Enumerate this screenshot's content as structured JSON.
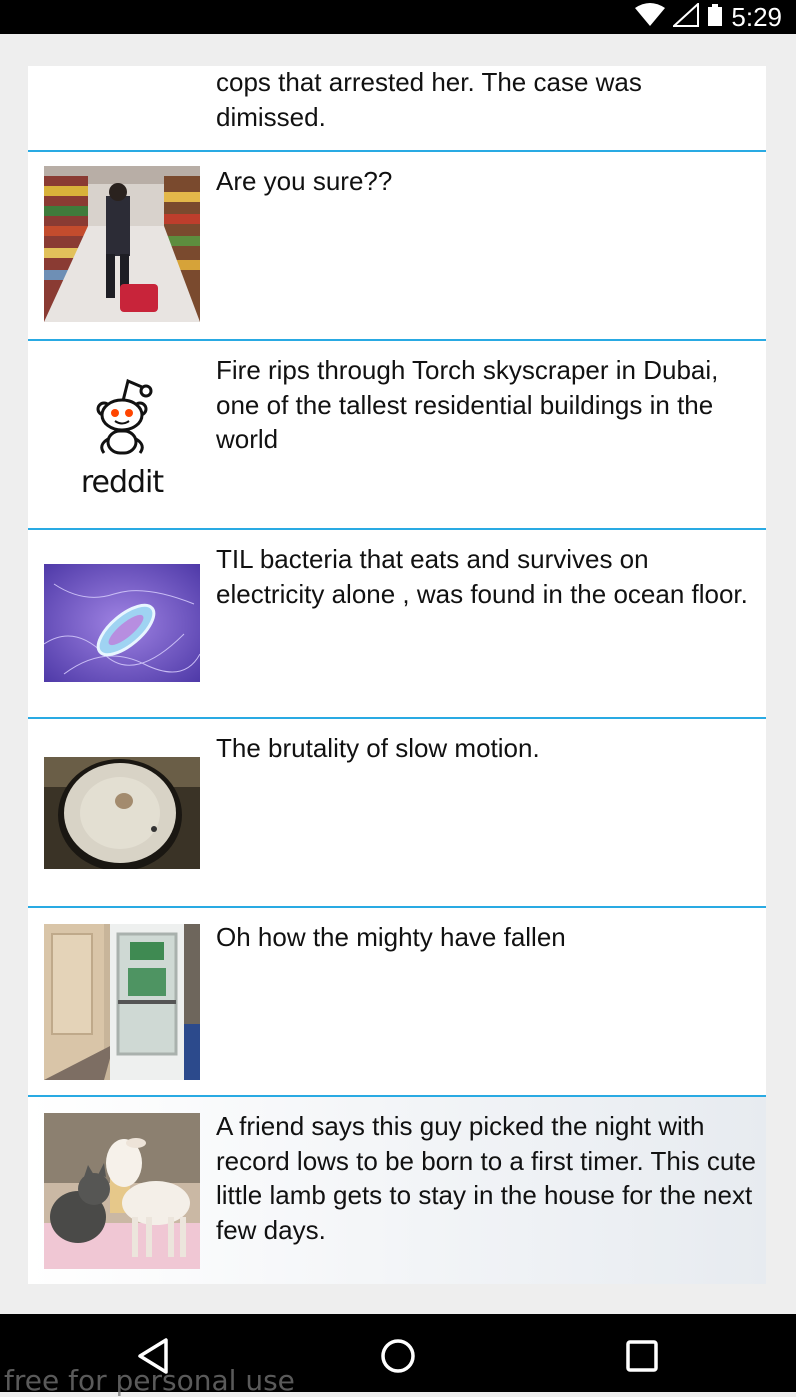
{
  "status_bar": {
    "time": "5:29",
    "icons": [
      "wifi-icon",
      "cell-signal-icon",
      "battery-icon"
    ]
  },
  "feed": {
    "posts": [
      {
        "title": "cops that arrested her. The case was dimissed.",
        "thumbnail": "none"
      },
      {
        "title": "Are you sure??",
        "thumbnail": "grocery-aisle-photo"
      },
      {
        "title": "Fire rips through Torch skyscraper in Dubai, one of the tallest residential buildings in the world",
        "thumbnail": "reddit-logo",
        "logo_text": "reddit"
      },
      {
        "title": "TIL bacteria that eats and survives on electricity alone , was found in the ocean floor.",
        "thumbnail": "bacteria-photo"
      },
      {
        "title": "The brutality of slow motion.",
        "thumbnail": "slow-motion-photo"
      },
      {
        "title": "Oh how the mighty have fallen",
        "thumbnail": "doorway-photo"
      },
      {
        "title": "A friend says this guy picked the night with record lows to be born to a first timer. This cute little lamb gets to stay in the house for the next few days.",
        "thumbnail": "lamb-photo"
      }
    ]
  },
  "nav_bar": {
    "buttons": [
      "back-icon",
      "home-icon",
      "recents-icon"
    ]
  },
  "watermark": "free for personal use",
  "colors": {
    "divider": "#29aae3",
    "background": "#eeeeee",
    "bars": "#000000"
  }
}
